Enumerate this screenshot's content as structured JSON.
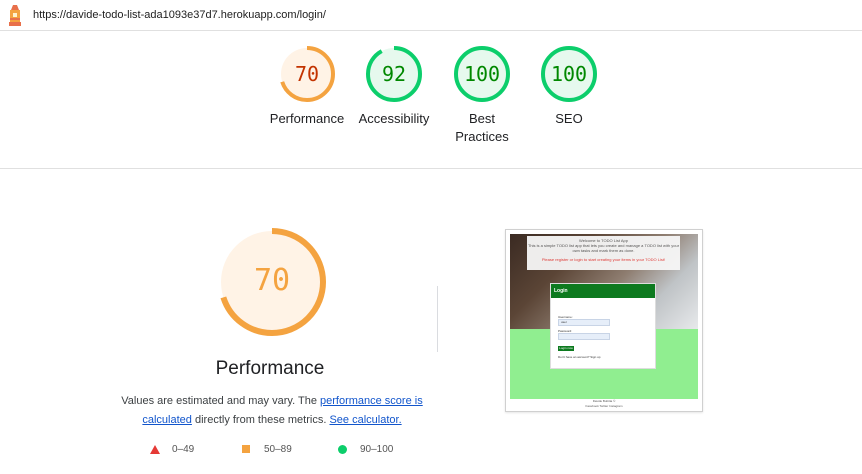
{
  "topbar": {
    "url": "https://davide-todo-list-ada1093e37d7.herokuapp.com/login/"
  },
  "gauges": [
    {
      "label": "Performance",
      "score": "70",
      "fraction": 0.7,
      "color": "#f4a340",
      "text_color": "#c33300",
      "bg": "#fff3e6"
    },
    {
      "label": "Accessibility",
      "score": "92",
      "fraction": 0.92,
      "color": "#0cce6b",
      "text_color": "#008800",
      "bg": "#e6f9ee"
    },
    {
      "label": "Best Practices",
      "score": "100",
      "fraction": 1.0,
      "color": "#0cce6b",
      "text_color": "#008800",
      "bg": "#e6f9ee"
    },
    {
      "label": "SEO",
      "score": "100",
      "fraction": 1.0,
      "color": "#0cce6b",
      "text_color": "#008800",
      "bg": "#e6f9ee"
    }
  ],
  "performance": {
    "score": "70",
    "fraction": 0.7,
    "color": "#f4a340",
    "title": "Performance",
    "desc_pre": "Values are estimated and may vary. The ",
    "link1": "performance score is calculated",
    "desc_mid": " directly from these metrics. ",
    "link2": "See calculator."
  },
  "legend": [
    {
      "range": "0–49",
      "icon": "red-triangle-icon"
    },
    {
      "range": "50–89",
      "icon": "orange-square-icon"
    },
    {
      "range": "90–100",
      "icon": "green-circle-icon"
    }
  ],
  "screenshot": {
    "banner_title": "Welcome to TODO List App",
    "banner_text": "This is a simple TODO list app that lets you create and manage a TODO list with your own tasks and mark them as done.",
    "banner_cta": "Please register or login to start creating your items in your TODO List!",
    "card_title": "Login",
    "username_label": "Username:",
    "username_value": "user",
    "password_label": "Password:",
    "login_button": "Login now",
    "register_text": "Don't have an account? Sign up",
    "footer_title": "Davide Buttitta ©",
    "footer_links": "Facebook   Twitter   Instagram"
  }
}
